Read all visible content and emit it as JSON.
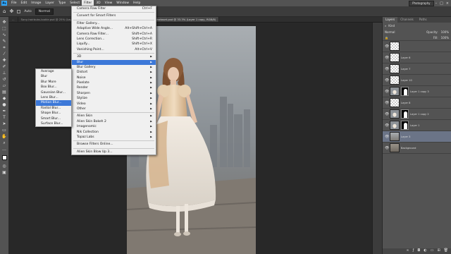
{
  "app": {
    "logo": "Ps",
    "workspace": "Photography"
  },
  "menubar": {
    "items": [
      "File",
      "Edit",
      "Image",
      "Layer",
      "Type",
      "Select",
      "Filter",
      "3D",
      "View",
      "Window",
      "Help"
    ],
    "active": "Filter"
  },
  "options": {
    "auto_select": "Auto",
    "mode": "Normal"
  },
  "tabs": [
    {
      "label": "...",
      "active": false
    },
    {
      "label": "Sony-hairbubs-lookie.psd @ 25% (Layer 3, RGB/8)",
      "active": false
    },
    {
      "label": "Easy hairbubs kids-the-moment-stock-model-photoset.psd @ 33.3% (Layer 1 copy, RGB/8)",
      "active": true
    }
  ],
  "filter_menu": {
    "items": [
      {
        "label": "Camera Raw Filter",
        "shortcut": "Ctrl+F"
      },
      {
        "sep": true
      },
      {
        "label": "Convert for Smart Filters"
      },
      {
        "sep": true
      },
      {
        "label": "Filter Gallery..."
      },
      {
        "label": "Adaptive Wide Angle...",
        "shortcut": "Alt+Shift+Ctrl+A"
      },
      {
        "label": "Camera Raw Filter...",
        "shortcut": "Shift+Ctrl+A"
      },
      {
        "label": "Lens Correction...",
        "shortcut": "Shift+Ctrl+R"
      },
      {
        "label": "Liquify...",
        "shortcut": "Shift+Ctrl+X"
      },
      {
        "label": "Vanishing Point...",
        "shortcut": "Alt+Ctrl+V"
      },
      {
        "sep": true
      },
      {
        "label": "3D",
        "sub": true
      },
      {
        "label": "Blur",
        "sub": true,
        "highlight": true
      },
      {
        "label": "Blur Gallery",
        "sub": true
      },
      {
        "label": "Distort",
        "sub": true
      },
      {
        "label": "Noise",
        "sub": true
      },
      {
        "label": "Pixelate",
        "sub": true
      },
      {
        "label": "Render",
        "sub": true
      },
      {
        "label": "Sharpen",
        "sub": true
      },
      {
        "label": "Stylize",
        "sub": true
      },
      {
        "label": "Video",
        "sub": true
      },
      {
        "label": "Other",
        "sub": true
      },
      {
        "sep": true
      },
      {
        "label": "Alien Skin",
        "sub": true
      },
      {
        "label": "Alien Skin Bokeh 2",
        "sub": true
      },
      {
        "label": "Imagenomic",
        "sub": true
      },
      {
        "label": "Nik Collection",
        "sub": true
      },
      {
        "label": "Topaz Labs",
        "sub": true
      },
      {
        "sep": true
      },
      {
        "label": "Browse Filters Online..."
      },
      {
        "sep": true
      },
      {
        "label": "Alien Skin Blow Up 3..."
      }
    ]
  },
  "blur_menu": {
    "items": [
      {
        "label": "Average"
      },
      {
        "label": "Blur"
      },
      {
        "label": "Blur More"
      },
      {
        "label": "Box Blur..."
      },
      {
        "label": "Gaussian Blur..."
      },
      {
        "label": "Lens Blur..."
      },
      {
        "label": "Motion Blur...",
        "highlight": true
      },
      {
        "label": "Radial Blur..."
      },
      {
        "label": "Shape Blur..."
      },
      {
        "label": "Smart Blur..."
      },
      {
        "label": "Surface Blur..."
      }
    ]
  },
  "panels": {
    "tabs": [
      "Layers",
      "Channels",
      "Paths"
    ],
    "active_tab": "Layers",
    "kind": "Kind",
    "blend": "Normal",
    "opacity_label": "Opacity:",
    "opacity": "100%",
    "fill_label": "Fill:",
    "fill": "100%",
    "layers": [
      {
        "name": "",
        "thumb": "checker",
        "mask": false
      },
      {
        "name": "Layer 6",
        "thumb": "checker",
        "mask": false
      },
      {
        "name": "Layer 7",
        "thumb": "checker",
        "mask": false
      },
      {
        "name": "Layer 10",
        "thumb": "checker",
        "mask": false
      },
      {
        "name": "Layer 1 copy 3",
        "thumb": "figure",
        "mask": true
      },
      {
        "name": "Layer 8",
        "thumb": "checker",
        "mask": false
      },
      {
        "name": "Layer 1 copy 2",
        "thumb": "figure",
        "mask": true
      },
      {
        "name": "Layer 1",
        "thumb": "figure",
        "mask": true
      },
      {
        "name": "Layer 3",
        "thumb": "sky",
        "mask": false,
        "selected": true
      },
      {
        "name": "Background",
        "thumb": "ground",
        "mask": false
      }
    ]
  },
  "colors": {
    "menubar": "#535353",
    "highlight": "#3c78d8",
    "ps_blue": "#31a8ff",
    "layer_selected": "#6b7487"
  }
}
